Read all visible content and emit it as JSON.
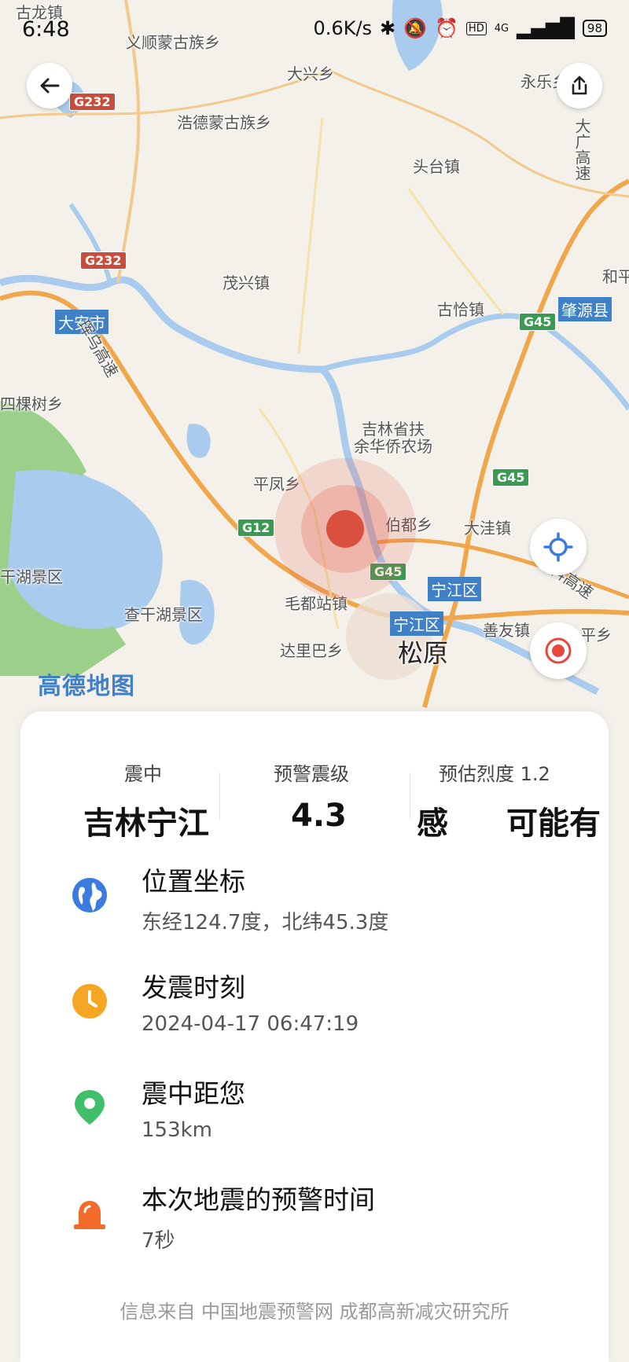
{
  "status_bar": {
    "time": "6:48",
    "net_speed": "0.6K/s",
    "network_type": "4G",
    "hd_badge": "HD",
    "battery": "98"
  },
  "toolbar": {
    "back_icon": "arrow-left-icon",
    "share_icon": "share-icon",
    "locate_icon": "crosshair-icon",
    "epicenter_icon": "target-icon"
  },
  "map": {
    "watermark": "高德地图",
    "labels": [
      "古龙镇",
      "义顺蒙古族乡",
      "大兴乡",
      "永乐乡",
      "浩德蒙古族乡",
      "头台镇",
      "茂兴镇",
      "古恰镇",
      "和平",
      "四棵树乡",
      "吉林省扶",
      "余华侨农场",
      "平凤乡",
      "伯都乡",
      "大洼镇",
      "干湖景区",
      "查干湖景区",
      "毛都站镇",
      "善友镇",
      "达里巴乡",
      "平乡"
    ],
    "city": "松原",
    "boxes": [
      "大安市",
      "肇源县",
      "宁江区",
      "宁江区"
    ],
    "shields": [
      "G232",
      "G232",
      "G45",
      "G45",
      "G12",
      "G45"
    ],
    "highways": [
      "大广高速",
      "铁科高速",
      "珲乌高速"
    ]
  },
  "info_panel": {
    "epicenter_label": "震中",
    "epicenter_value": "吉林宁江",
    "magnitude_label": "预警震级",
    "magnitude_value": "4.3",
    "intensity_label": "预估烈度 1.2",
    "intensity_value": "感",
    "extra_value": "可能有",
    "rows": [
      {
        "icon": "globe-icon",
        "color": "#3b7be0",
        "title": "位置坐标",
        "subtitle": "东经124.7度，北纬45.3度"
      },
      {
        "icon": "clock-icon",
        "color": "#f5a623",
        "title": "发震时刻",
        "subtitle": "2024-04-17 06:47:19"
      },
      {
        "icon": "location-pin-icon",
        "color": "#3fbf6a",
        "title": "震中距您",
        "subtitle": "153km"
      },
      {
        "icon": "alarm-icon",
        "color": "#f26b2a",
        "title": "本次地震的预警时间",
        "subtitle": "7秒"
      }
    ],
    "footer": "信息来自 中国地震预警网 成都高新减灾研究所"
  },
  "colors": {
    "map_bg": "#f4f1ea",
    "water": "#a9cbed",
    "green": "#9ccf8a",
    "road": "#f0a64a",
    "epicenter": "#d9503f",
    "accent_blue": "#3b7be0"
  }
}
